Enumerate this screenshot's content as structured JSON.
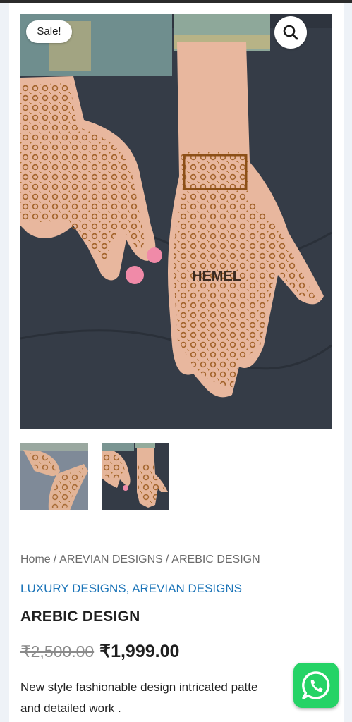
{
  "product": {
    "sale_badge": "Sale!",
    "breadcrumb": [
      "Home",
      "AREVIAN DESIGNS",
      "AREBIC DESIGN"
    ],
    "breadcrumb_separator": "/",
    "categories": [
      "LUXURY DESIGNS",
      "AREVIAN DESIGNS"
    ],
    "categories_separator": ",",
    "title": "AREBIC DESIGN",
    "old_price": "₹2,500.00",
    "new_price": "₹1,999.00",
    "description_line1": "New style fashionable design intricated patte",
    "description_line2": "and  detailed work ."
  },
  "gallery": {
    "main_image_alt": "henna-hands-main",
    "thumbnails": [
      "henna-hands-thumb-1",
      "henna-hands-thumb-2"
    ],
    "image_text": "HEMEL"
  },
  "icons": {
    "zoom": "search-icon",
    "whatsapp": "whatsapp-icon"
  },
  "colors": {
    "link": "#1b74b8",
    "whatsapp": "#25d366",
    "henna": "#9a5a1e",
    "skin": "#e8b79e"
  }
}
